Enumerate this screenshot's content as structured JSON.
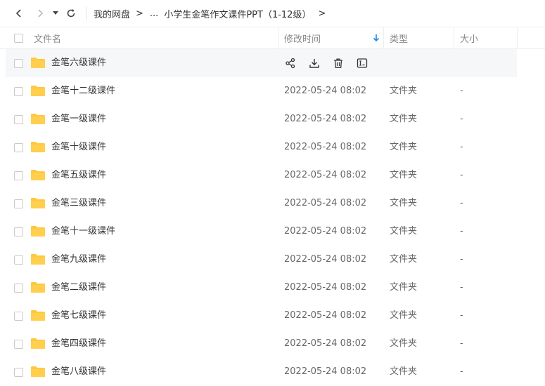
{
  "breadcrumb": {
    "root": "我的网盘",
    "separator": ">",
    "ellipsis": "...",
    "current": "小学生金笔作文课件PPT（1-12级）"
  },
  "columns": {
    "name": "文件名",
    "modified": "修改时间",
    "type": "类型",
    "size": "大小"
  },
  "icons": {
    "back": "chevron-left-icon",
    "forward": "chevron-right-icon",
    "history": "caret-down-icon",
    "refresh": "refresh-icon",
    "sort": "arrow-down-icon",
    "folder": "folder-icon",
    "share": "share-icon",
    "download": "download-icon",
    "delete": "trash-icon",
    "rename": "rename-icon"
  },
  "colors": {
    "folder": "#ffc83d",
    "sort_arrow": "#1e88e5",
    "hover_row": "#f6f7f9"
  },
  "rows": [
    {
      "name": "金笔六级课件",
      "date": "",
      "type": "",
      "size": "",
      "hovered": true
    },
    {
      "name": "金笔十二级课件",
      "date": "2022-05-24 08:02",
      "type": "文件夹",
      "size": "-"
    },
    {
      "name": "金笔一级课件",
      "date": "2022-05-24 08:02",
      "type": "文件夹",
      "size": "-"
    },
    {
      "name": "金笔十级课件",
      "date": "2022-05-24 08:02",
      "type": "文件夹",
      "size": "-"
    },
    {
      "name": "金笔五级课件",
      "date": "2022-05-24 08:02",
      "type": "文件夹",
      "size": "-"
    },
    {
      "name": "金笔三级课件",
      "date": "2022-05-24 08:02",
      "type": "文件夹",
      "size": "-"
    },
    {
      "name": "金笔十一级课件",
      "date": "2022-05-24 08:02",
      "type": "文件夹",
      "size": "-"
    },
    {
      "name": "金笔九级课件",
      "date": "2022-05-24 08:02",
      "type": "文件夹",
      "size": "-"
    },
    {
      "name": "金笔二级课件",
      "date": "2022-05-24 08:02",
      "type": "文件夹",
      "size": "-"
    },
    {
      "name": "金笔七级课件",
      "date": "2022-05-24 08:02",
      "type": "文件夹",
      "size": "-"
    },
    {
      "name": "金笔四级课件",
      "date": "2022-05-24 08:02",
      "type": "文件夹",
      "size": "-"
    },
    {
      "name": "金笔八级课件",
      "date": "2022-05-24 08:02",
      "type": "文件夹",
      "size": "-"
    }
  ]
}
